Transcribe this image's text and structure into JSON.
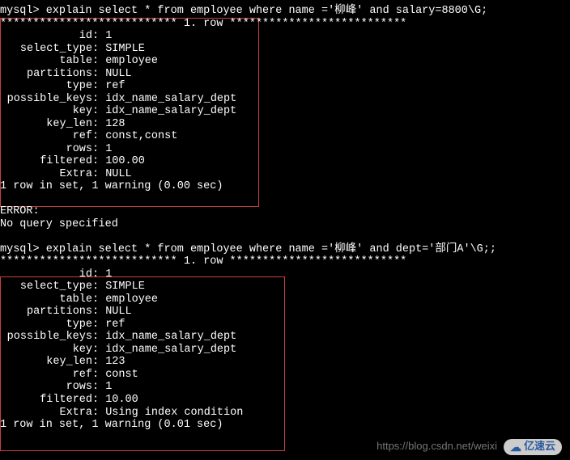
{
  "prompt1": "mysql> explain select * from employee where name ='柳峰' and salary=8800\\G;",
  "sep1": "*************************** 1. row ***************************",
  "result1": {
    "id": "1",
    "select_type": "SIMPLE",
    "table": "employee",
    "partitions": "NULL",
    "type": "ref",
    "possible_keys": "idx_name_salary_dept",
    "key": "idx_name_salary_dept",
    "key_len": "128",
    "ref": "const,const",
    "rows": "1",
    "filtered": "100.00",
    "Extra": "NULL"
  },
  "summary1": "1 row in set, 1 warning (0.00 sec)",
  "error_label": "ERROR:",
  "error_msg": "No query specified",
  "prompt2": "mysql> explain select * from employee where name ='柳峰' and dept='部门A'\\G;;",
  "sep2": "*************************** 1. row ***************************",
  "result2": {
    "id": "1",
    "select_type": "SIMPLE",
    "table": "employee",
    "partitions": "NULL",
    "type": "ref",
    "possible_keys": "idx_name_salary_dept",
    "key": "idx_name_salary_dept",
    "key_len": "123",
    "ref": "const",
    "rows": "1",
    "filtered": "10.00",
    "Extra": "Using index condition"
  },
  "summary2": "1 row in set, 1 warning (0.01 sec)",
  "labels": {
    "id": "id",
    "select_type": "select_type",
    "table": "table",
    "partitions": "partitions",
    "type": "type",
    "possible_keys": "possible_keys",
    "key": "key",
    "key_len": "key_len",
    "ref": "ref",
    "rows": "rows",
    "filtered": "filtered",
    "Extra": "Extra"
  },
  "watermark_text": "https://blog.csdn.net/weixi",
  "logo_text": "亿速云"
}
